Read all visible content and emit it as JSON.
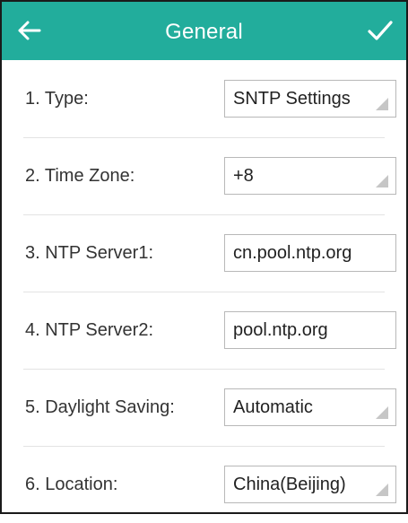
{
  "header": {
    "title": "General",
    "back_icon": "arrow-left-icon",
    "confirm_icon": "checkmark-icon",
    "bg_color": "#22ad9c"
  },
  "rows": [
    {
      "label": "1. Type:",
      "value": "SNTP Settings",
      "kind": "select"
    },
    {
      "label": "2. Time Zone:",
      "value": "+8",
      "kind": "select"
    },
    {
      "label": "3. NTP Server1:",
      "value": "cn.pool.ntp.org",
      "kind": "input"
    },
    {
      "label": "4. NTP Server2:",
      "value": "pool.ntp.org",
      "kind": "input"
    },
    {
      "label": "5. Daylight Saving:",
      "value": "Automatic",
      "kind": "select"
    },
    {
      "label": "6. Location:",
      "value": "China(Beijing)",
      "kind": "select"
    }
  ]
}
